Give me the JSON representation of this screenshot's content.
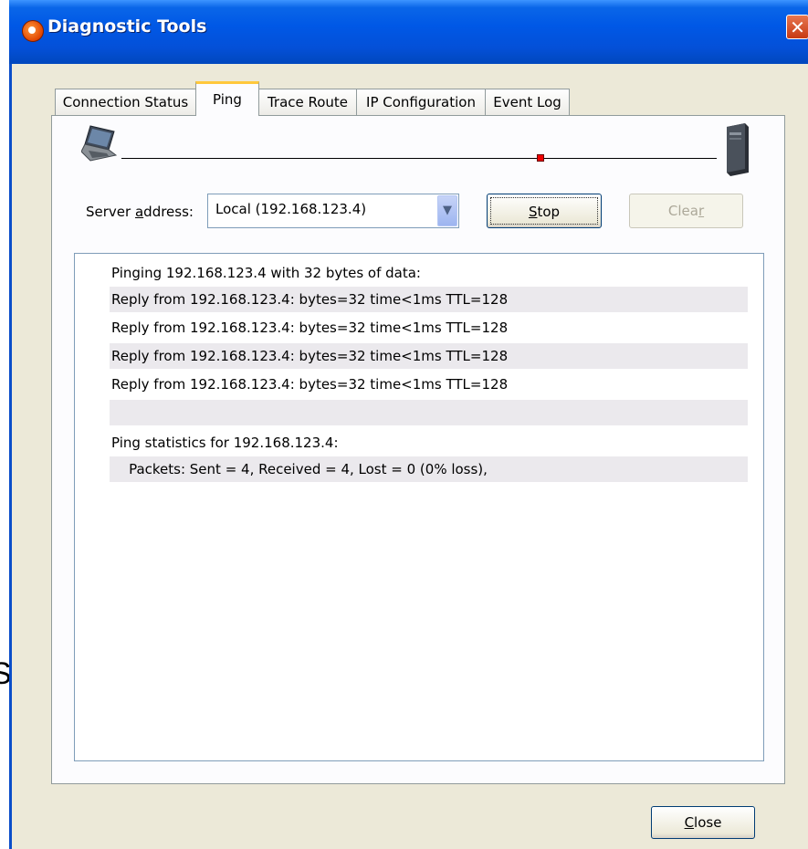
{
  "background": {
    "letter": "S"
  },
  "window": {
    "title": "Diagnostic Tools",
    "close_glyph": "✕",
    "colors": {
      "titlebar": "#0058e6",
      "face": "#ece9d8",
      "close": "#c73a14",
      "tab_highlight": "#ffc83c",
      "marker": "#e00000"
    }
  },
  "tabs": [
    {
      "label": "Connection Status",
      "active": false
    },
    {
      "label": "Ping",
      "active": true
    },
    {
      "label": "Trace Route",
      "active": false
    },
    {
      "label": "IP Configuration",
      "active": false
    },
    {
      "label": "Event Log",
      "active": false
    }
  ],
  "icons": [
    "laptop-icon",
    "server-icon",
    "app-icon",
    "close-icon",
    "dropdown-arrow-icon"
  ],
  "server": {
    "label_prefix": "Server ",
    "label_accel": "a",
    "label_suffix": "ddress:",
    "selected": "Local (192.168.123.4)"
  },
  "buttons": {
    "stop": {
      "accel": "S",
      "rest": "top"
    },
    "clear": {
      "rest": "Clea",
      "accel": "r",
      "disabled": true
    },
    "close": {
      "accel": "C",
      "rest": "lose"
    }
  },
  "output_lines": [
    "Pinging 192.168.123.4 with 32 bytes of data:",
    "Reply from 192.168.123.4: bytes=32 time<1ms TTL=128",
    "Reply from 192.168.123.4: bytes=32 time<1ms TTL=128",
    "Reply from 192.168.123.4: bytes=32 time<1ms TTL=128",
    "Reply from 192.168.123.4: bytes=32 time<1ms TTL=128",
    "",
    "Ping statistics for 192.168.123.4:",
    "    Packets: Sent = 4, Received = 4, Lost = 0 (0% loss),"
  ]
}
